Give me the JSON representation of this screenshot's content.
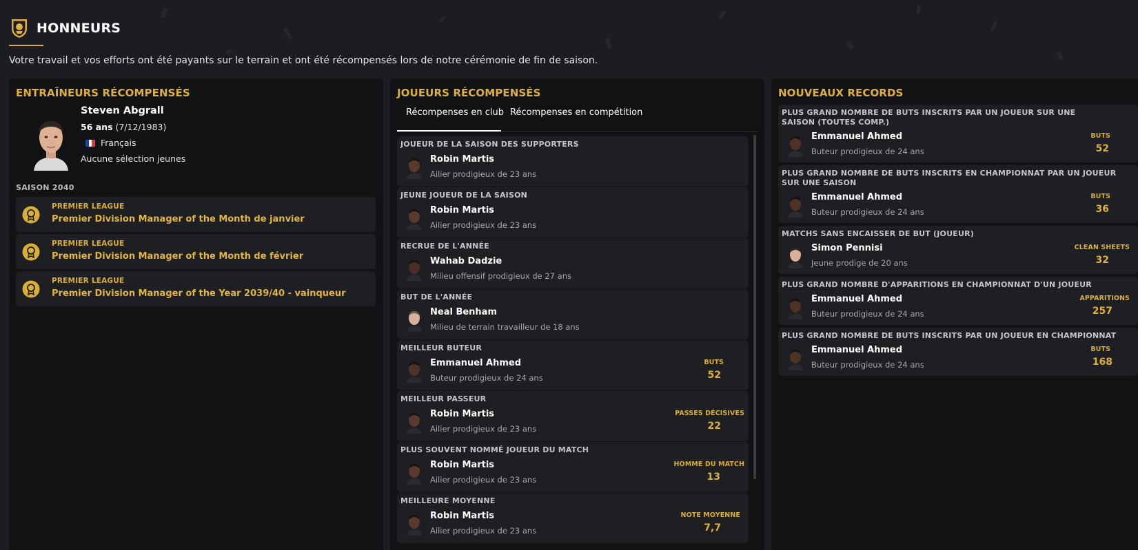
{
  "header": {
    "title": "HONNEURS",
    "subtitle": "Votre travail et vos efforts ont été payants sur le terrain et ont été récompensés lors de notre cérémonie de fin de saison."
  },
  "coaches": {
    "title": "ENTRAÎNEURS RÉCOMPENSÉS",
    "manager": {
      "name": "Steven Abgrall",
      "age": "56 ans",
      "dob": "(7/12/1983)",
      "nationality": "Français",
      "youth": "Aucune sélection jeunes"
    },
    "season_label": "SAISON 2040",
    "awards": [
      {
        "competition": "PREMIER LEAGUE",
        "name": "Premier Division Manager of the Month de janvier"
      },
      {
        "competition": "PREMIER LEAGUE",
        "name": "Premier Division Manager of the Month de février"
      },
      {
        "competition": "PREMIER LEAGUE",
        "name": "Premier Division Manager of the Year 2039/40 - vainqueur"
      }
    ]
  },
  "players": {
    "title": "JOUEURS RÉCOMPENSÉS",
    "tabs": [
      "Récompenses en club",
      "Récompenses en compétition"
    ],
    "awards": [
      {
        "title": "JOUEUR DE LA SAISON DES SUPPORTERS",
        "player": "Robin Martis",
        "desc": "Ailier prodigieux de 23 ans",
        "stat_label": "",
        "stat_value": ""
      },
      {
        "title": "JEUNE JOUEUR DE LA SAISON",
        "player": "Robin Martis",
        "desc": "Ailier prodigieux de 23 ans",
        "stat_label": "",
        "stat_value": ""
      },
      {
        "title": "RECRUE DE L'ANNÉE",
        "player": "Wahab Dadzie",
        "desc": "Milieu offensif prodigieux de 27 ans",
        "stat_label": "",
        "stat_value": ""
      },
      {
        "title": "BUT DE L'ANNÉE",
        "player": "Neal Benham",
        "desc": "Milieu de terrain travailleur de 18 ans",
        "stat_label": "",
        "stat_value": ""
      },
      {
        "title": "MEILLEUR BUTEUR",
        "player": "Emmanuel Ahmed",
        "desc": "Buteur prodigieux de 24 ans",
        "stat_label": "BUTS",
        "stat_value": "52"
      },
      {
        "title": "MEILLEUR PASSEUR",
        "player": "Robin Martis",
        "desc": "Ailier prodigieux de 23 ans",
        "stat_label": "PASSES DÉCISIVES",
        "stat_value": "22"
      },
      {
        "title": "PLUS SOUVENT NOMMÉ JOUEUR DU MATCH",
        "player": "Robin Martis",
        "desc": "Ailier prodigieux de 23 ans",
        "stat_label": "HOMME DU MATCH",
        "stat_value": "13"
      },
      {
        "title": "MEILLEURE MOYENNE",
        "player": "Robin Martis",
        "desc": "Ailier prodigieux de 23 ans",
        "stat_label": "NOTE MOYENNE",
        "stat_value": "7,7"
      }
    ]
  },
  "records": {
    "title": "NOUVEAUX RECORDS",
    "items": [
      {
        "title": "PLUS GRAND NOMBRE DE BUTS INSCRITS PAR UN JOUEUR SUR UNE SAISON (TOUTES COMP.)",
        "player": "Emmanuel Ahmed",
        "desc": "Buteur prodigieux de 24 ans",
        "stat_label": "BUTS",
        "stat_value": "52"
      },
      {
        "title": "PLUS GRAND NOMBRE DE BUTS INSCRITS EN CHAMPIONNAT PAR UN JOUEUR SUR UNE SAISON",
        "player": "Emmanuel Ahmed",
        "desc": "Buteur prodigieux de 24 ans",
        "stat_label": "BUTS",
        "stat_value": "36"
      },
      {
        "title": "MATCHS SANS ENCAISSER DE BUT (JOUEUR)",
        "player": "Simon Pennisi",
        "desc": "Jeune prodige de 20 ans",
        "stat_label": "CLEAN SHEETS",
        "stat_value": "32"
      },
      {
        "title": "PLUS GRAND NOMBRE D'APPARITIONS EN CHAMPIONNAT D'UN JOUEUR",
        "player": "Emmanuel Ahmed",
        "desc": "Buteur prodigieux de 24 ans",
        "stat_label": "APPARITIONS",
        "stat_value": "257"
      },
      {
        "title": "PLUS GRAND NOMBRE DE BUTS INSCRITS PAR UN JOUEUR EN CHAMPIONNAT",
        "player": "Emmanuel Ahmed",
        "desc": "Buteur prodigieux de 24 ans",
        "stat_label": "BUTS",
        "stat_value": "168"
      }
    ]
  },
  "colors": {
    "background": "#1c1d22",
    "panel": "#111214",
    "card": "#1e1f23",
    "accent_gold": "#e0b13a",
    "text_muted": "#a7a7ab"
  },
  "icons": {
    "crest": "club-crest-icon",
    "medal": "medal-icon",
    "flag": "france-flag-icon"
  }
}
